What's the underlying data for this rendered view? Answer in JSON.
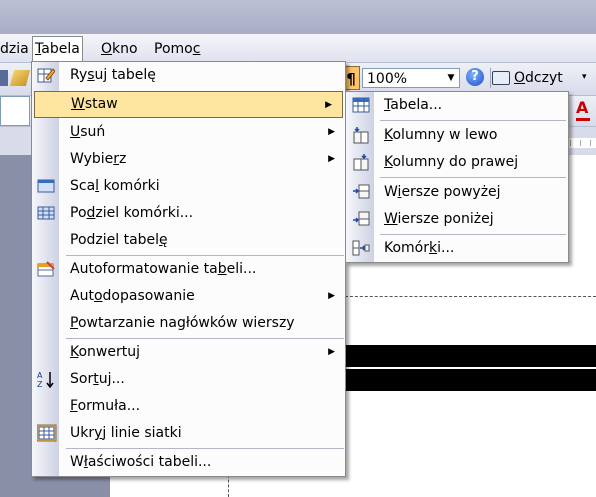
{
  "menubar": {
    "items": [
      {
        "label": "dzia",
        "accel": ""
      },
      {
        "label": "Tabela",
        "accel": "T"
      },
      {
        "label": "Okno",
        "accel": "O"
      },
      {
        "label": "Pomoc",
        "accel": "c"
      }
    ]
  },
  "toolbar": {
    "zoom": "100%",
    "pilcrow": "¶",
    "help": "?",
    "reading_label": "Odczyt"
  },
  "menu": {
    "items": [
      {
        "label": "Rysuj tabelę",
        "icon": "pencil-table-icon"
      },
      {
        "label": "Wstaw",
        "icon": "",
        "submenu": true
      },
      {
        "label": "Usuń",
        "icon": "",
        "submenu": true
      },
      {
        "label": "Wybierz",
        "icon": "",
        "submenu": true
      },
      {
        "label": "Scal komórki",
        "icon": "merge-cells-icon"
      },
      {
        "label": "Podziel komórki...",
        "icon": "split-cells-icon"
      },
      {
        "label": "Podziel tabelę",
        "icon": ""
      },
      {
        "label": "Autoformatowanie tabeli...",
        "icon": "autoformat-icon"
      },
      {
        "label": "Autodopasowanie",
        "icon": "",
        "submenu": true
      },
      {
        "label": "Powtarzanie nagłówków wierszy",
        "icon": ""
      },
      {
        "label": "Konwertuj",
        "icon": "",
        "submenu": true
      },
      {
        "label": "Sortuj...",
        "icon": "sort-az-icon"
      },
      {
        "label": "Formuła...",
        "icon": ""
      },
      {
        "label": "Ukryj linie siatki",
        "icon": "gridlines-icon"
      },
      {
        "label": "Właściwości tabeli...",
        "icon": ""
      }
    ]
  },
  "submenu": {
    "items": [
      {
        "label": "Tabela...",
        "icon": "insert-table-icon"
      },
      {
        "label": "Kolumny w lewo",
        "icon": "insert-column-left-icon"
      },
      {
        "label": "Kolumny do prawej",
        "icon": "insert-column-right-icon"
      },
      {
        "label": "Wiersze powyżej",
        "icon": "insert-row-above-icon"
      },
      {
        "label": "Wiersze poniżej",
        "icon": "insert-row-below-icon"
      },
      {
        "label": "Komórki...",
        "icon": "insert-cells-icon"
      }
    ]
  },
  "colors": {
    "highlight": "#ffe6a0",
    "menu_bg": "#fcfcfc"
  }
}
